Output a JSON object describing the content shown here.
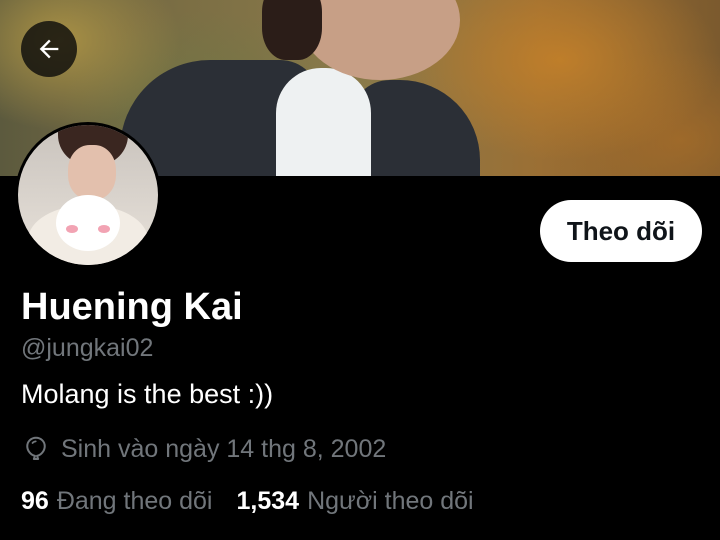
{
  "header": {
    "back_icon": "arrow-left-icon"
  },
  "profile": {
    "name": "Huening Kai",
    "handle": "@jungkai02",
    "bio": "Molang is the best :))",
    "birth_icon": "balloon-icon",
    "birth_text": "Sinh vào ngày 14 thg 8, 2002",
    "follow_label": "Theo dõi"
  },
  "stats": {
    "following_count": "96",
    "following_label": "Đang theo dõi",
    "followers_count": "1,534",
    "followers_label": "Người theo dõi"
  },
  "colors": {
    "background": "#000000",
    "primary_text": "#ffffff",
    "secondary_text": "#71767b",
    "button_bg": "#ffffff",
    "button_text": "#0f1419"
  }
}
